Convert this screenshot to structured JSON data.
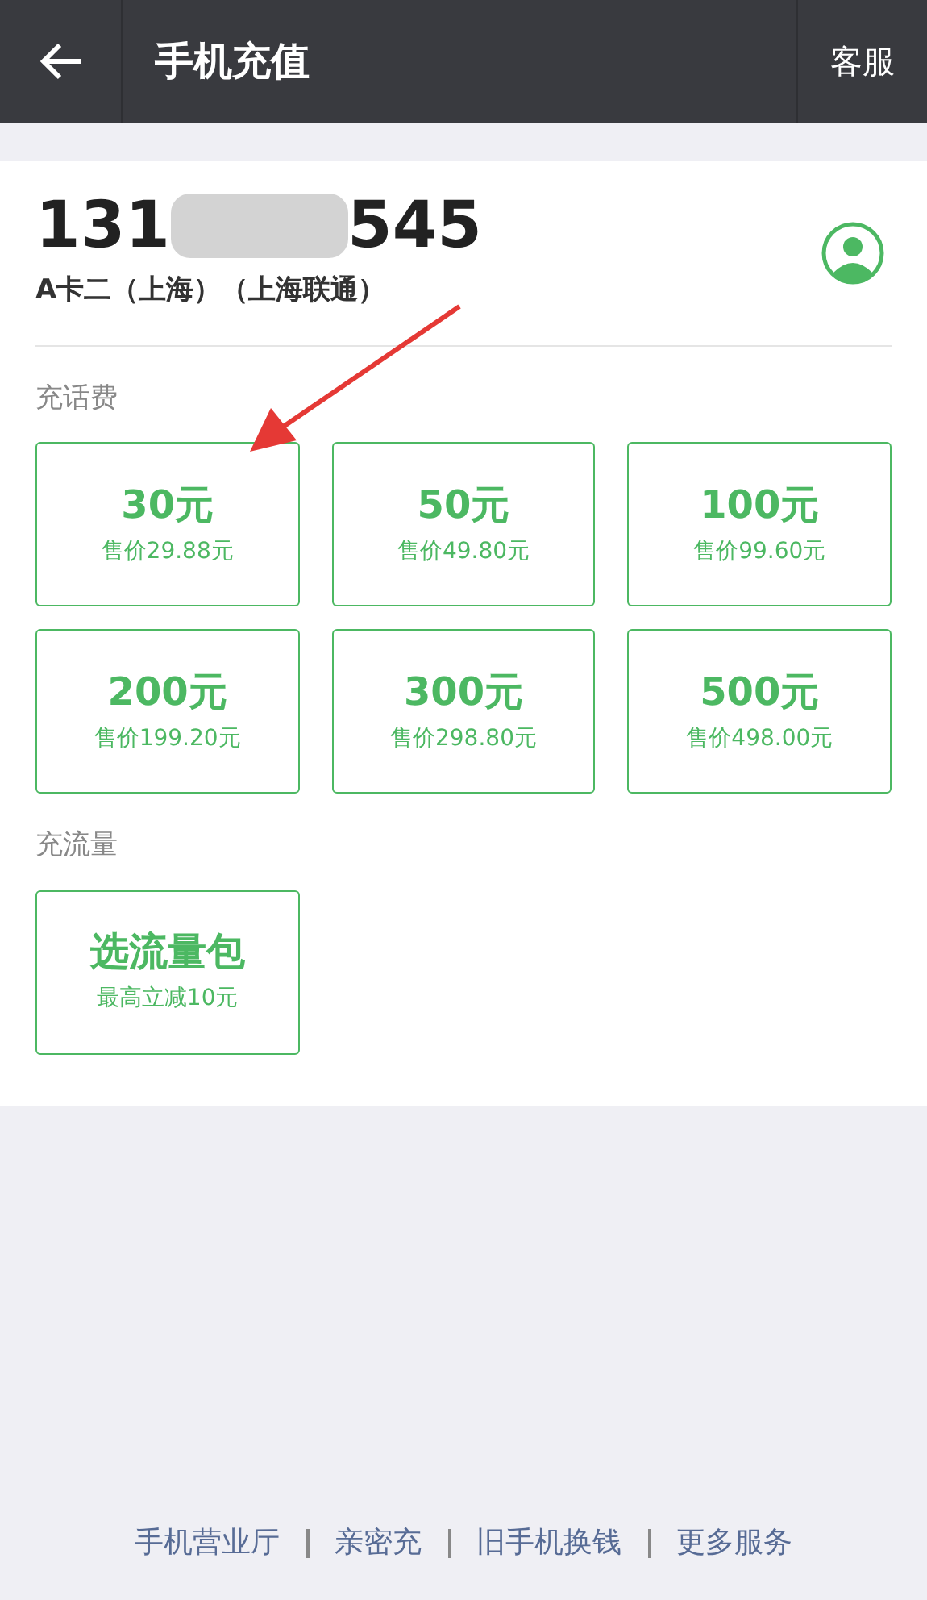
{
  "header": {
    "title": "手机充值",
    "action": "客服"
  },
  "account": {
    "number_start": "131",
    "number_end": "545",
    "carrier": "A卡二（上海）（上海联通）"
  },
  "sections": [
    {
      "title": "充话费",
      "items": [
        {
          "amount": "30元",
          "price": "售价29.88元"
        },
        {
          "amount": "50元",
          "price": "售价49.80元"
        },
        {
          "amount": "100元",
          "price": "售价99.60元"
        },
        {
          "amount": "200元",
          "price": "售价199.20元"
        },
        {
          "amount": "300元",
          "price": "售价298.80元"
        },
        {
          "amount": "500元",
          "price": "售价498.00元"
        }
      ]
    },
    {
      "title": "充流量",
      "items": [
        {
          "amount": "选流量包",
          "price": "最高立减10元"
        }
      ]
    }
  ],
  "footer_links": [
    "手机营业厅",
    "亲密充",
    "旧手机换钱",
    "更多服务"
  ]
}
